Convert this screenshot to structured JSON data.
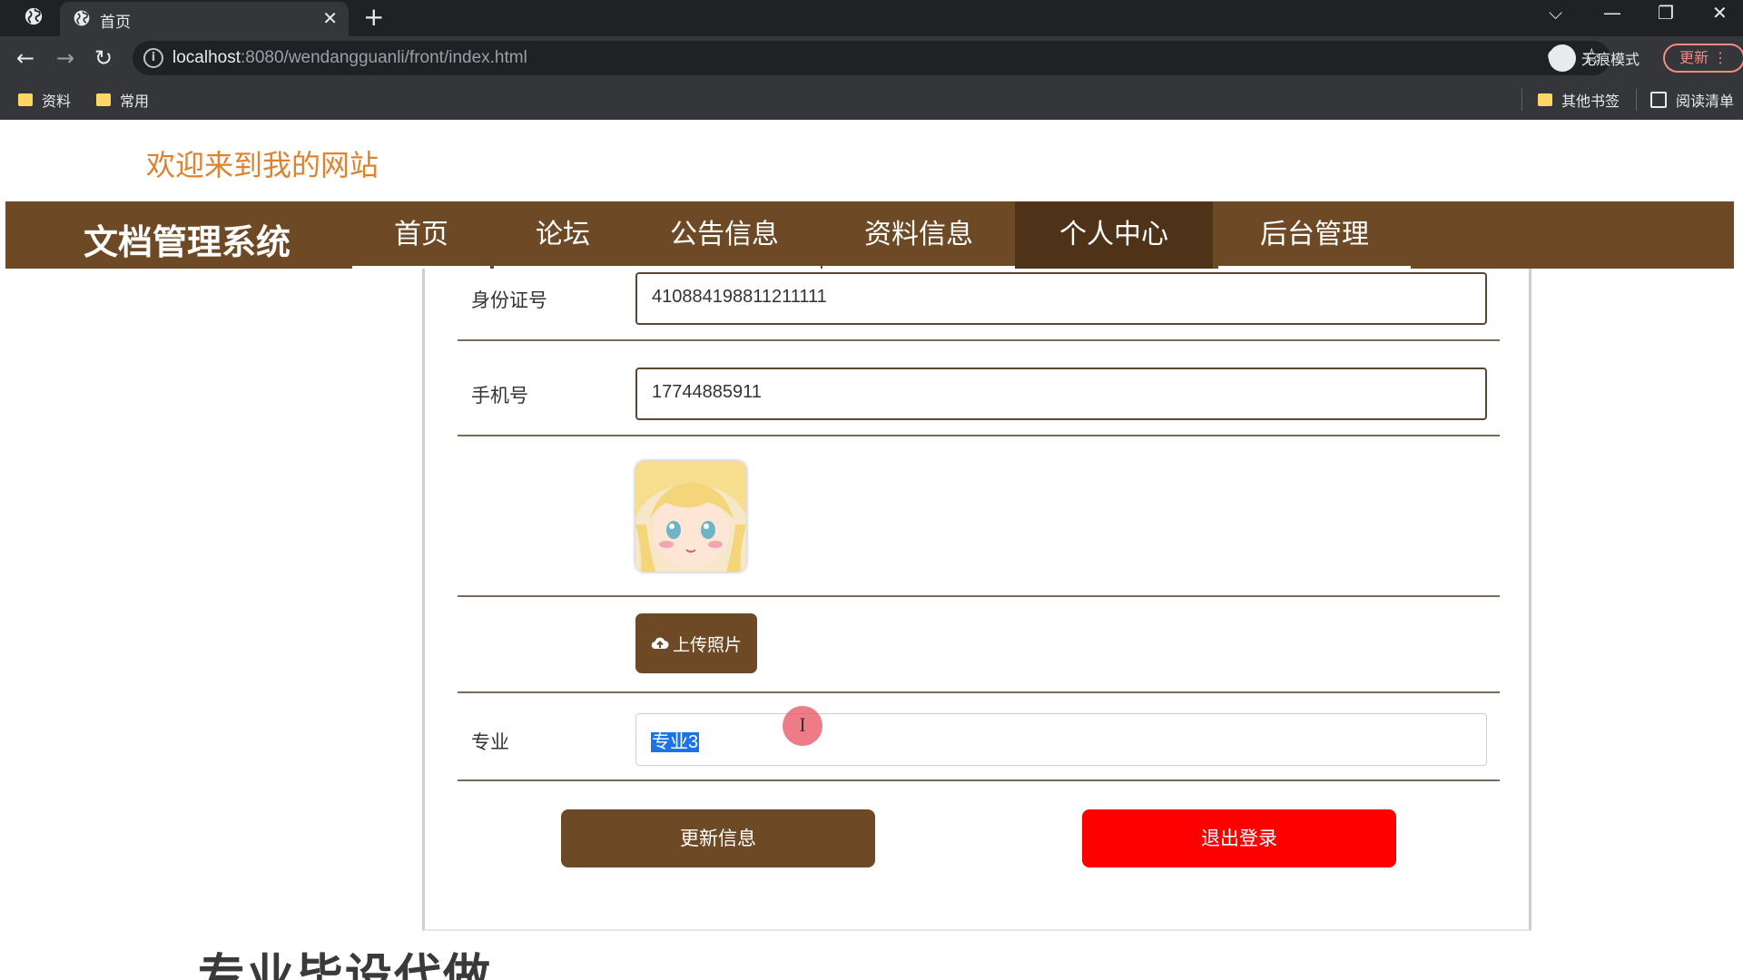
{
  "browser": {
    "tab_title": "首页",
    "url_host": "localhost",
    "url_rest": ":8080/wendangguanli/front/index.html",
    "incognito_label": "无痕模式",
    "update_label": "更新",
    "bookmarks": [
      "资料",
      "常用"
    ],
    "other_bookmarks": "其他书签",
    "reading_list": "阅读清单"
  },
  "site": {
    "welcome": "欢迎来到我的网站",
    "brand": "文档管理系统",
    "nav": [
      "首页",
      "论坛",
      "公告信息",
      "资料信息",
      "个人中心",
      "后台管理"
    ],
    "active_nav": "个人中心"
  },
  "form": {
    "id_label": "身份证号",
    "id_value": "410884198811211111",
    "phone_label": "手机号",
    "phone_value": "17744885911",
    "upload_label": "上传照片",
    "major_label": "专业",
    "major_value": "专业3",
    "update_button": "更新信息",
    "logout_button": "退出登录"
  },
  "overlay": {
    "watermark": "专业毕设代做"
  },
  "colors": {
    "brand_brown": "#6d4a25",
    "active_nav": "#4f3318",
    "welcome_orange": "#e0822d",
    "logout_red": "#ff0000"
  }
}
